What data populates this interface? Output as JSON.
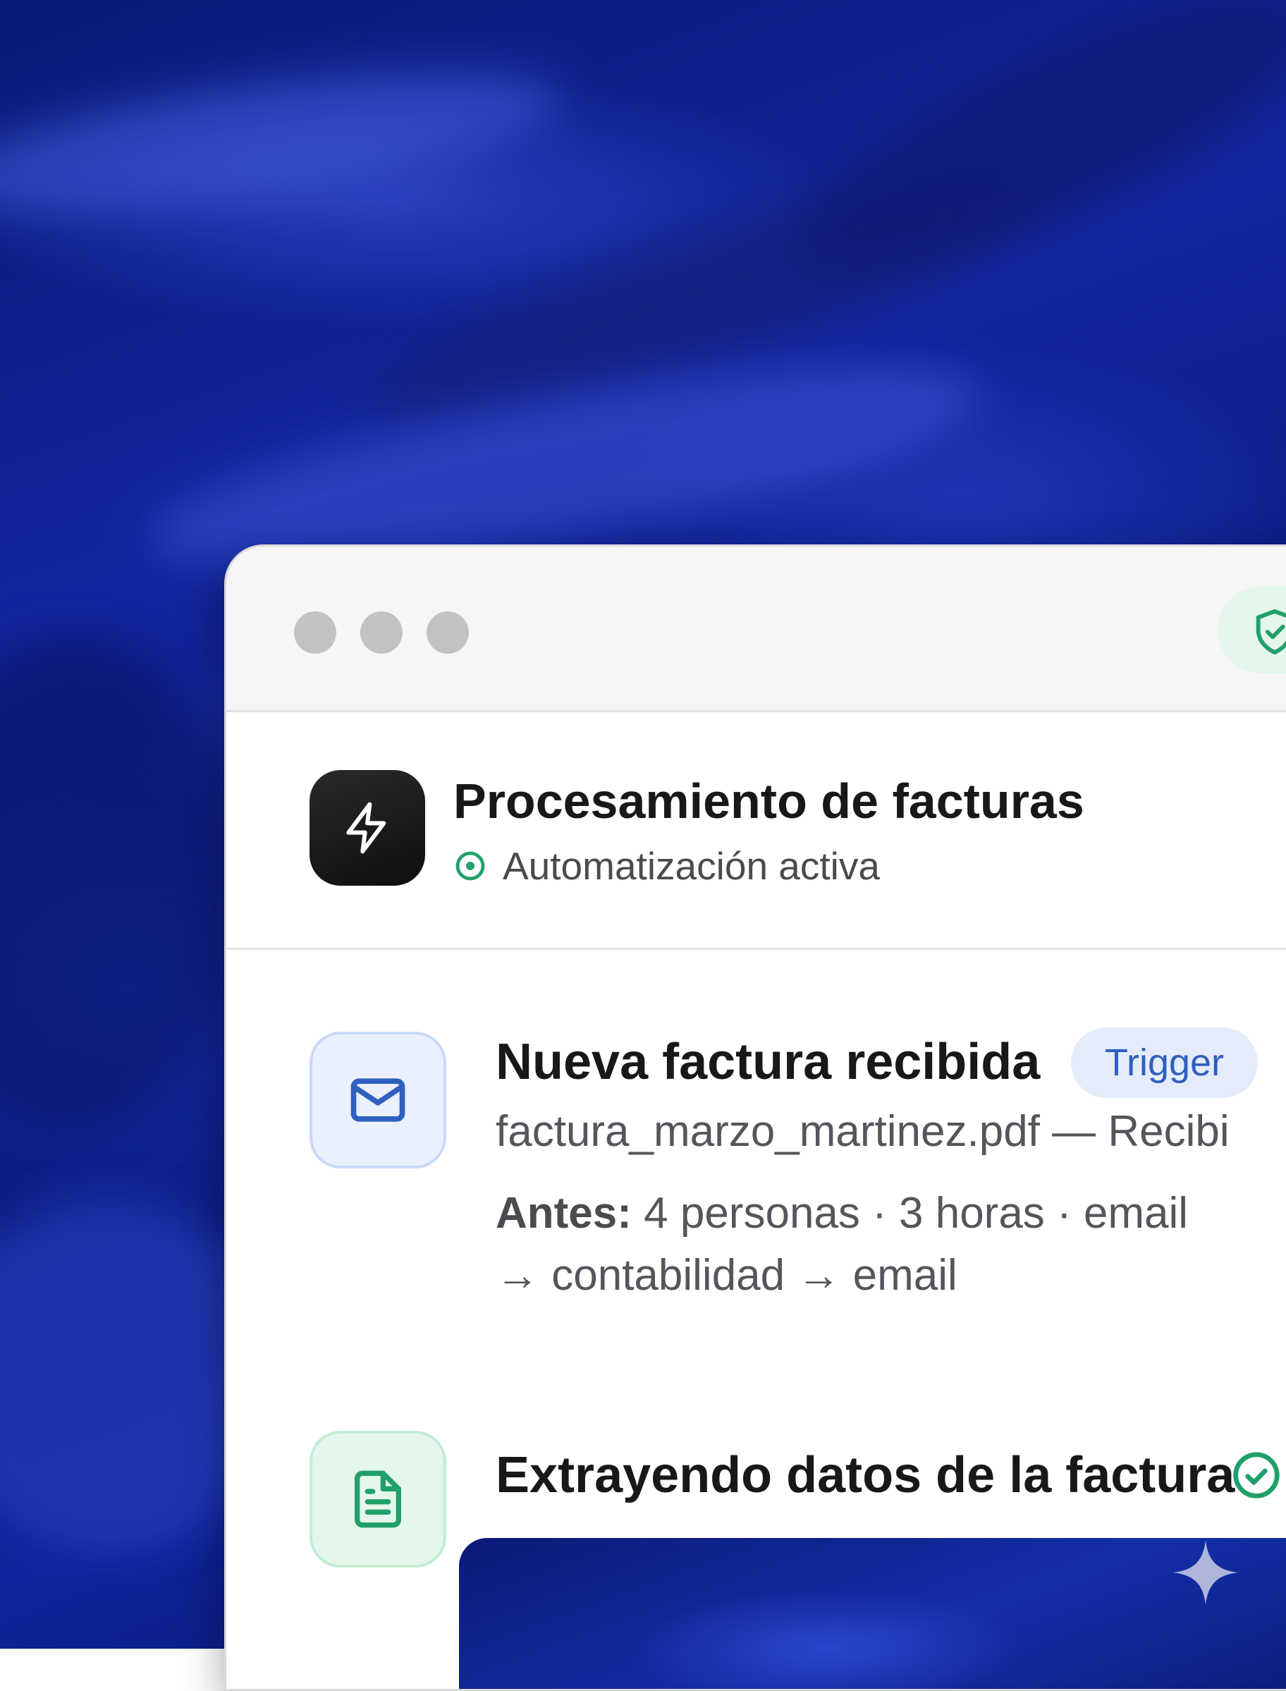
{
  "window": {
    "title": "Procesamiento de facturas",
    "status": "Automatización activa",
    "traffic_lights": [
      "close",
      "minimize",
      "maximize"
    ],
    "header_icon": "lightning-icon",
    "secure_badge_icon": "shield-check-icon"
  },
  "steps": [
    {
      "icon": "mail-icon",
      "title": "Nueva factura recibida",
      "badge": "Trigger",
      "filename": "factura_marzo_martinez.pdf — Recibi",
      "before_label": "Antes:",
      "before_text": "4 personas · 3 horas · email → contabilidad → email"
    },
    {
      "icon": "document-icon",
      "title": "Extrayendo datos de la factura",
      "status_icon": "check-circle-icon"
    }
  ],
  "colors": {
    "accent_green": "#22a06b",
    "accent_blue": "#2f5fbf",
    "background_fabric": "#12249c"
  }
}
